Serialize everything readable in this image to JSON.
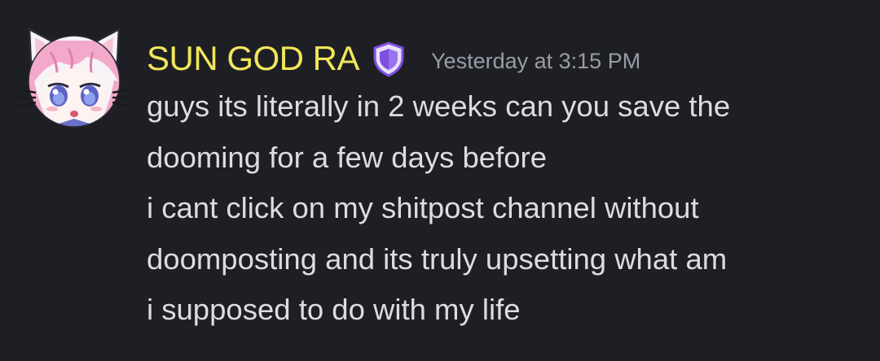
{
  "message": {
    "author": {
      "username": "SUN GOD RA",
      "username_color": "#f1e65a",
      "badge_icon": "purple-shield-badge-icon",
      "badge_color": "#7e4fe0",
      "avatar_icon": "pink-hair-cat-ears-anime-avatar"
    },
    "timestamp": "Yesterday at 3:15 PM",
    "lines": [
      "guys its literally in 2 weeks can you save the",
      "dooming for a few days before",
      "i cant click on my shitpost channel without",
      "doomposting and its truly upsetting what am",
      "i supposed to do with my life"
    ]
  },
  "colors": {
    "background": "#1e1f24",
    "text": "#dcdde1",
    "timestamp": "#9a9ca4"
  }
}
